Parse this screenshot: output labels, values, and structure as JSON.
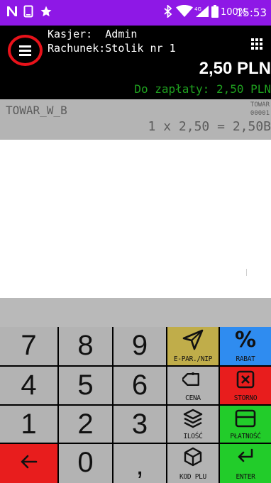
{
  "status_bar": {
    "icons": [
      "n-notification-icon",
      "screenshot-icon",
      "star-icon",
      "bluetooth-icon",
      "wifi-icon",
      "signal-icon",
      "battery-icon"
    ],
    "network_type": "4G",
    "battery": "100%",
    "time": "15:53"
  },
  "header": {
    "cashier_label": "Kasjer:",
    "cashier_value": "Admin",
    "receipt_label": "Rachunek:",
    "receipt_value": "Stolik nr 1",
    "total": "2,50 PLN",
    "to_pay_label": "Do zapłaty:",
    "to_pay_value": "2,50 PLN",
    "menu_icon": "hamburger-menu-icon",
    "grid_icon": "grid-icon"
  },
  "item": {
    "name": "TOWAR_W_B",
    "code1": "TOWAR",
    "code2": "00001",
    "quantity": "1",
    "times": "x",
    "price": "2,50",
    "equals": "=",
    "sum": "2,50B"
  },
  "keypad": {
    "digits": {
      "seven": "7",
      "eight": "8",
      "nine": "9",
      "four": "4",
      "five": "5",
      "six": "6",
      "one": "1",
      "two": "2",
      "three": "3",
      "zero": "0",
      "comma": ","
    },
    "epar_label": "E-PAR./NIP",
    "rabat_label": "RABAT",
    "rabat_glyph": "%",
    "cena_label": "CENA",
    "storno_label": "STORNO",
    "ilosc_label": "ILOŚĆ",
    "platnosc_label": "PŁATNOŚĆ",
    "kodplu_label": "KOD PLU",
    "enter_label": "ENTER",
    "colors": {
      "gray": "#b3b3b3",
      "olive": "#c0ad4a",
      "blue": "#2f8cf0",
      "red": "#e81d1d",
      "green": "#22cc2a",
      "status_bar": "#8e18e6",
      "to_pay": "#1fa11f"
    }
  }
}
